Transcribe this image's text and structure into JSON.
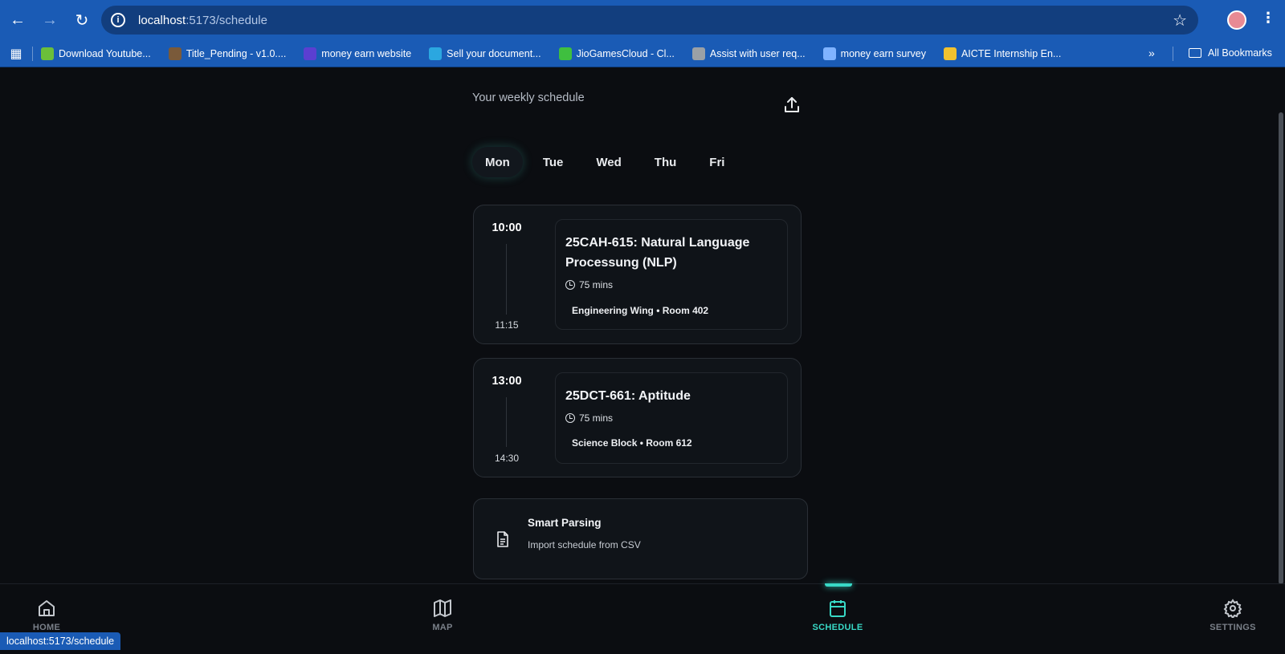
{
  "browser": {
    "url_host": "localhost",
    "url_path": ":5173/schedule",
    "bookmarks": [
      {
        "label": "Download Youtube...",
        "color": "#6bbf3a"
      },
      {
        "label": "Title_Pending - v1.0....",
        "color": "#7a5a3a"
      },
      {
        "label": "money earn website",
        "color": "#5b3fd1"
      },
      {
        "label": "Sell your document...",
        "color": "#2ba7e0"
      },
      {
        "label": "JioGamesCloud - Cl...",
        "color": "#3fbf3f"
      },
      {
        "label": "Assist with user req...",
        "color": "#9aa0a6"
      },
      {
        "label": "money earn survey",
        "color": "#7fb3ff"
      },
      {
        "label": "AICTE Internship En...",
        "color": "#f2c230"
      }
    ],
    "all_bookmarks_label": "All Bookmarks",
    "status_url": "localhost:5173/schedule"
  },
  "schedule": {
    "subtitle": "Your weekly schedule",
    "days": [
      "Mon",
      "Tue",
      "Wed",
      "Thu",
      "Fri"
    ],
    "active_day": "Mon",
    "classes": [
      {
        "start": "10:00",
        "end": "11:15",
        "course": "25CAH-615: Natural Language Processung (NLP)",
        "duration": "75 mins",
        "location": "Engineering Wing • Room 402"
      },
      {
        "start": "13:00",
        "end": "14:30",
        "course": "25DCT-661: Aptitude",
        "duration": "75 mins",
        "location": "Science Block • Room 612"
      }
    ],
    "smart_parsing": {
      "title": "Smart Parsing",
      "subtitle": "Import schedule from CSV"
    }
  },
  "nav": {
    "home": "HOME",
    "map": "MAP",
    "schedule": "SCHEDULE",
    "settings": "SETTINGS"
  },
  "colors": {
    "accent": "#38d9c6",
    "browser_blue": "#1a5bb5",
    "background": "#0b0d11"
  }
}
